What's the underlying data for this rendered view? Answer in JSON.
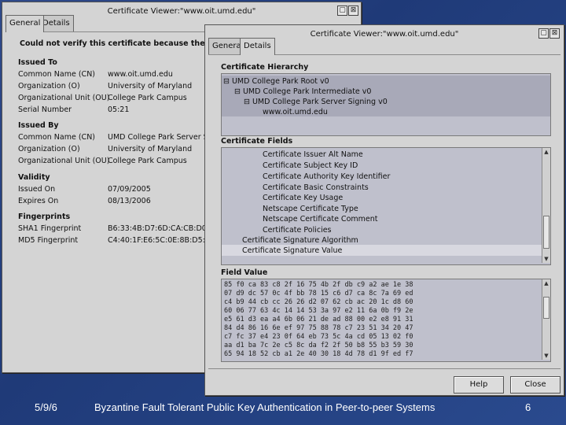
{
  "back_window": {
    "title": "Certificate Viewer:\"www.oit.umd.edu\"",
    "tabs": [
      "General",
      "Details"
    ],
    "warning": "Could not verify this certificate because the issuer i",
    "issued_to": {
      "heading": "Issued To",
      "rows": [
        {
          "label": "Common Name (CN)",
          "value": "www.oit.umd.edu"
        },
        {
          "label": "Organization (O)",
          "value": "University of Maryland"
        },
        {
          "label": "Organizational Unit (OU)",
          "value": "College Park Campus"
        },
        {
          "label": "Serial Number",
          "value": "05:21"
        }
      ]
    },
    "issued_by": {
      "heading": "Issued By",
      "rows": [
        {
          "label": "Common Name (CN)",
          "value": "UMD College Park Server S"
        },
        {
          "label": "Organization (O)",
          "value": "University of Maryland"
        },
        {
          "label": "Organizational Unit (OU)",
          "value": "College Park Campus"
        }
      ]
    },
    "validity": {
      "heading": "Validity",
      "rows": [
        {
          "label": "Issued On",
          "value": "07/09/2005"
        },
        {
          "label": "Expires On",
          "value": "08/13/2006"
        }
      ]
    },
    "fingerprints": {
      "heading": "Fingerprints",
      "rows": [
        {
          "label": "SHA1 Fingerprint",
          "value": "B6:33:4B:D7:6D:CA:CB:D0"
        },
        {
          "label": "MD5 Fingerprint",
          "value": "C4:40:1F:E6:5C:0E:8B:D5:A"
        }
      ]
    }
  },
  "front_window": {
    "title": "Certificate Viewer:\"www.oit.umd.edu\"",
    "tabs": [
      "Genera",
      "Details"
    ],
    "hierarchy_label": "Certificate Hierarchy",
    "hierarchy": [
      "⊟ UMD College Park Root v0",
      "⊟ UMD College Park Intermediate v0",
      "⊟ UMD College Park Server Signing v0",
      "www.oit.umd.edu"
    ],
    "fields_label": "Certificate Fields",
    "fields": [
      "Certificate Issuer Alt Name",
      "Certificate Subject Key ID",
      "Certificate Authority Key Identifier",
      "Certificate Basic Constraints",
      "Certificate Key Usage",
      "Netscape Certificate Type",
      "Netscape Certificate Comment",
      "Certificate Policies",
      "Certificate Signature Algorithm",
      "Certificate Signature Value"
    ],
    "field_value_label": "Field Value",
    "hex_lines": [
      "85 f0 ca 83 c8 2f 16 75 4b 2f db c9 a2 ae 1e 38",
      "07 d9 dc 57 0c 4f bb 78 15 c6 d7 ca 8c 7a 69 ed",
      "c4 b9 44 cb cc 26 26 d2 07 62 cb ac 20 1c d8 60",
      "60 06 77 63 4c 14 14 53 3a 97 e2 11 6a 0b f9 2e",
      "e5 61 d3 ea a4 6b 06 21 de ad 88 00 e2 e8 91 31",
      "84 d4 86 16 6e ef 97 75 88 78 c7 23 51 34 20 47",
      "c7 fc 37 e4 23 0f 64 eb 73 5c 4a cd 05 13 02 f0",
      "aa d1 ba 7c 2e c5 8c da f2 2f 50 b8 55 b3 59 30",
      "65 94 18 52 cb a1 2e 40 30 18 4d 78 d1 9f ed f7"
    ],
    "help_button": "Help",
    "close_button": "Close"
  },
  "footer": {
    "date": "5/9/6",
    "title": "Byzantine Fault Tolerant Public Key Authentication in Peer-to-peer Systems",
    "page": "6"
  }
}
